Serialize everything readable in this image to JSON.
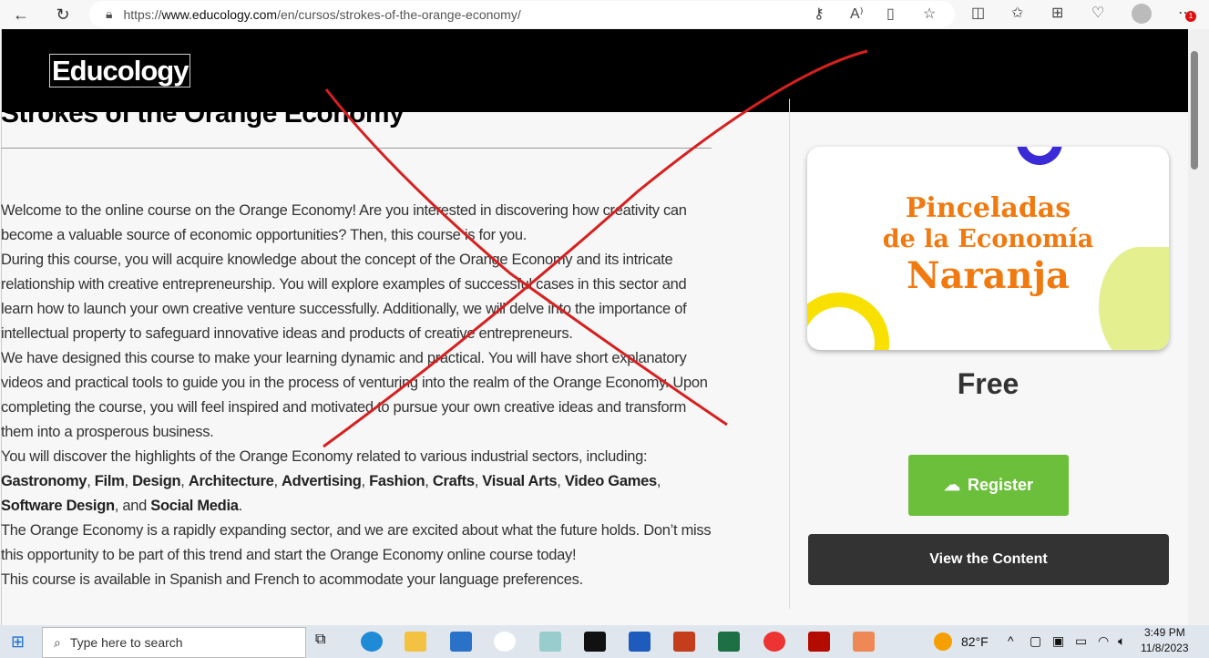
{
  "browser": {
    "url_prefix": "https://",
    "url_domain": "www.educology.com",
    "url_path": "/en/cursos/strokes-of-the-orange-economy/",
    "notification_count": "1"
  },
  "site": {
    "logo": "Educology"
  },
  "course": {
    "title": "Strokes of the Orange Economy",
    "p1": "Welcome to the online course on the Orange Economy! Are you interested in discovering how creativity can become a valuable source of economic opportunities? Then, this course is for you.",
    "p2": "During this course, you will acquire knowledge about the concept of the Orange Economy and its intricate relationship with creative entrepreneurship. You will explore examples of successful cases in this sector and learn how to launch your own creative venture successfully. Additionally, we will delve into the importance of intellectual property to safeguard innovative ideas and products of creative entrepreneurs.",
    "p3": "We have designed this course to make your learning dynamic and practical. You will have short explanatory videos and practical tools to guide you in the process of venturing into the realm of the Orange Economy. Upon completing the course, you will feel inspired and motivated to pursue your own creative ideas and transform them into a prosperous business.",
    "p4": "You will discover the highlights of the Orange Economy related to various industrial sectors, including:",
    "sectors": [
      "Gastronomy",
      "Film",
      "Design",
      "Architecture",
      "Advertising",
      "Fashion",
      "Crafts",
      "Visual Arts",
      "Video Games",
      "Software Design"
    ],
    "and_word": ", and",
    "last_sector": "Social Media",
    "p5": "The Orange Economy is a rapidly expanding sector, and we are excited about what the future holds. Don’t miss this opportunity to be part of this trend and start the Orange Economy online course today!",
    "p6": "This course is available in Spanish and French to acommodate your language preferences.",
    "thumb_line1": "Pinceladas",
    "thumb_line2": "de la Economía",
    "thumb_line3": "Naranja",
    "price": "Free",
    "register": "Register",
    "view_content": "View the Content"
  },
  "taskbar": {
    "search_placeholder": "Type here to search",
    "temp": "82°F",
    "time": "3:49 PM",
    "date": "11/8/2023"
  },
  "colors": {
    "green": "#6cbf3b",
    "dark": "#333333",
    "orange": "#f07a10",
    "annotation": "#d62020"
  }
}
